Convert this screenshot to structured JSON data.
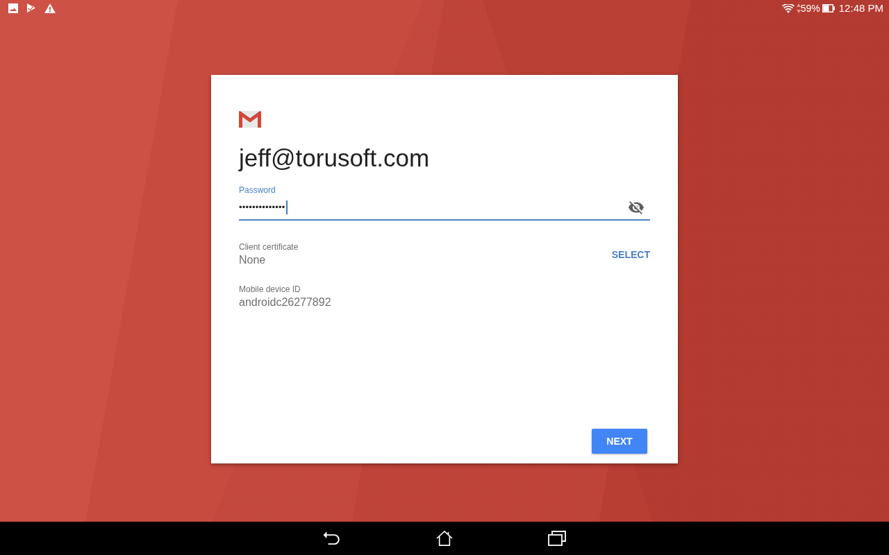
{
  "status_bar": {
    "battery": "59%",
    "time": "12:48 PM"
  },
  "sign_in_card": {
    "email": "jeff@torusoft.com",
    "password": {
      "label": "Password",
      "value": "••••••••••••••",
      "focused": true
    },
    "fields": [
      {
        "label": "Client certificate",
        "value": "None",
        "action": "SELECT"
      },
      {
        "label": "Mobile device ID",
        "value": "androidc26277892"
      }
    ],
    "next_button": "NEXT"
  }
}
